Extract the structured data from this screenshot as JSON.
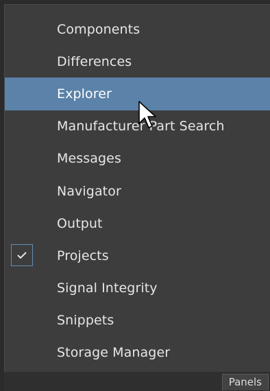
{
  "menu": {
    "items": [
      {
        "label": "Components",
        "checked": false,
        "hovered": false
      },
      {
        "label": "Differences",
        "checked": false,
        "hovered": false
      },
      {
        "label": "Explorer",
        "checked": false,
        "hovered": true
      },
      {
        "label": "Manufacturer Part Search",
        "checked": false,
        "hovered": false
      },
      {
        "label": "Messages",
        "checked": false,
        "hovered": false
      },
      {
        "label": "Navigator",
        "checked": false,
        "hovered": false
      },
      {
        "label": "Output",
        "checked": false,
        "hovered": false
      },
      {
        "label": "Projects",
        "checked": true,
        "hovered": false
      },
      {
        "label": "Signal Integrity",
        "checked": false,
        "hovered": false
      },
      {
        "label": "Snippets",
        "checked": false,
        "hovered": false
      },
      {
        "label": "Storage Manager",
        "checked": false,
        "hovered": false
      }
    ]
  },
  "status_bar": {
    "panels_label": "Panels"
  },
  "colors": {
    "menu_bg": "#3d3d3d",
    "hover_bg": "#5b82a8",
    "text": "#e6e6e6"
  },
  "icons": {
    "check": "check-icon",
    "cursor": "mouse-cursor-icon"
  }
}
